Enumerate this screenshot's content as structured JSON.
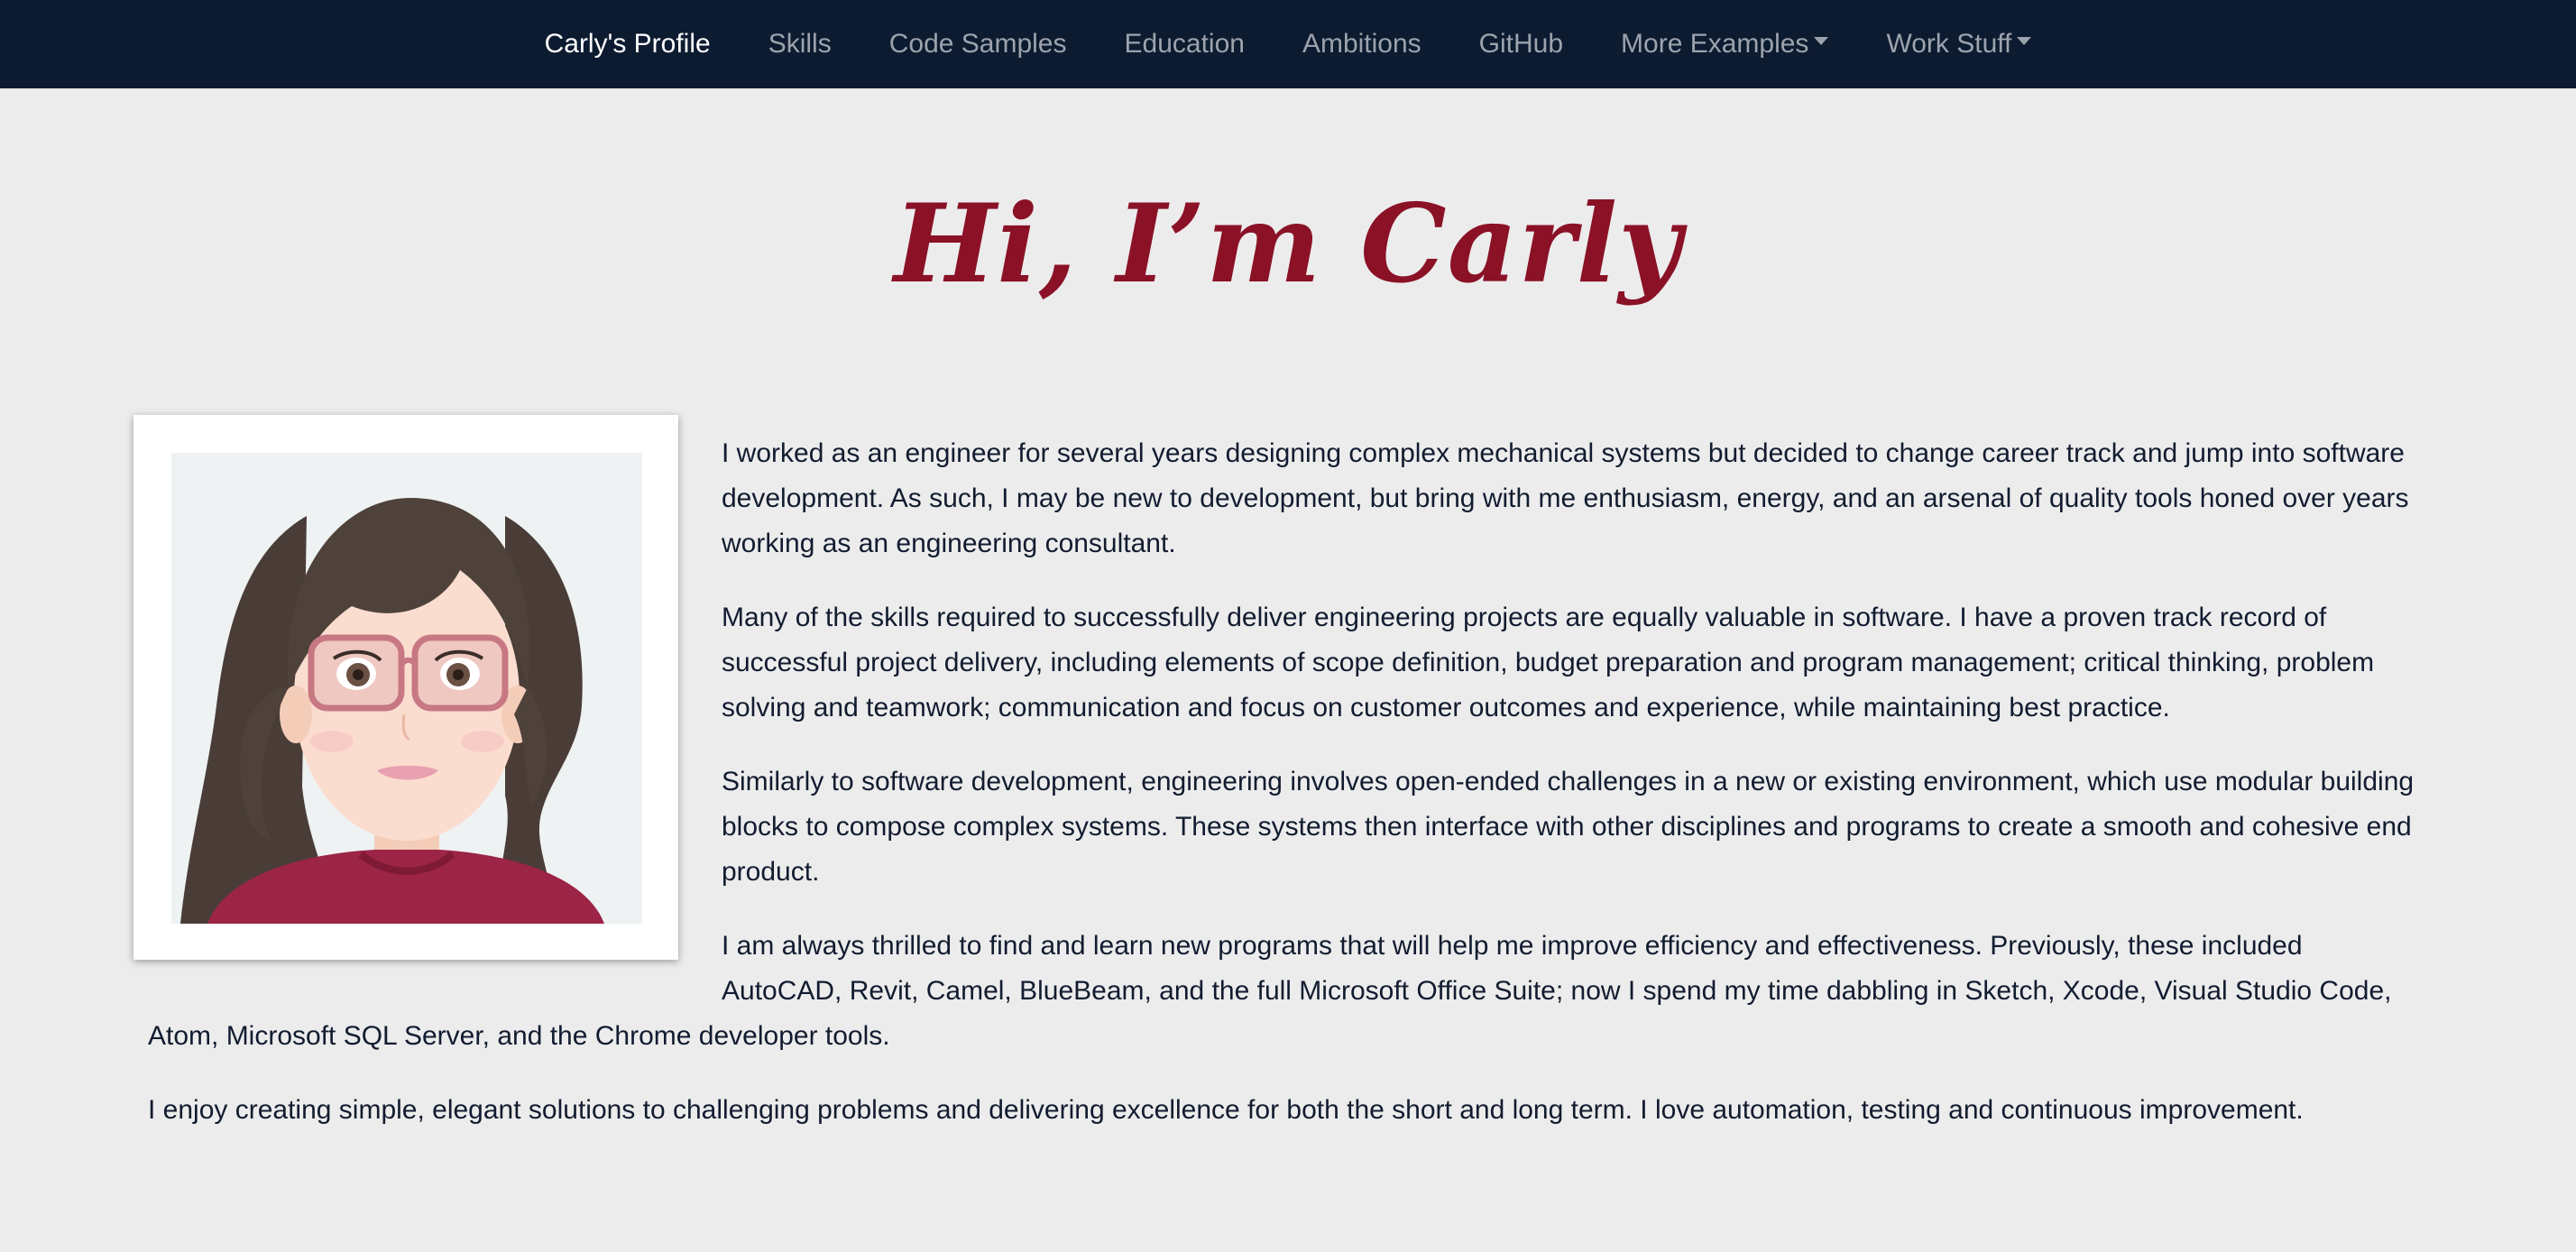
{
  "nav": {
    "items": [
      {
        "label": "Carly's Profile",
        "active": true,
        "dropdown": false
      },
      {
        "label": "Skills",
        "active": false,
        "dropdown": false
      },
      {
        "label": "Code Samples",
        "active": false,
        "dropdown": false
      },
      {
        "label": "Education",
        "active": false,
        "dropdown": false
      },
      {
        "label": "Ambitions",
        "active": false,
        "dropdown": false
      },
      {
        "label": "GitHub",
        "active": false,
        "dropdown": false
      },
      {
        "label": "More Examples",
        "active": false,
        "dropdown": true
      },
      {
        "label": "Work Stuff",
        "active": false,
        "dropdown": true
      }
    ]
  },
  "hero": {
    "title": "Hi, I’m Carly"
  },
  "portrait": {
    "icon": "avatar-illustration"
  },
  "about": {
    "paragraphs": [
      "I worked as an engineer for several years designing complex mechanical systems but decided to change career track and jump into software development. As such, I may be new to development, but bring with me enthusiasm, energy, and an arsenal of quality tools honed over years working as an engineering consultant.",
      "Many of the skills required to successfully deliver engineering projects are equally valuable in software. I have a proven track record of successful project delivery, including elements of scope definition, budget preparation and program management; critical thinking, problem solving and teamwork; communication and focus on customer outcomes and experience, while maintaining best practice.",
      "Similarly to software development, engineering involves open-ended challenges in a new or existing environment, which use modular building blocks to compose complex systems. These systems then interface with other disciplines and programs to create a smooth and cohesive end product.",
      "I am always thrilled to find and learn new programs that will help me improve efficiency and effectiveness. Previously, these included AutoCAD, Revit, Camel, BlueBeam, and the full Microsoft Office Suite; now I spend my time dabbling in Sketch, Xcode, Visual Studio Code, Atom, Microsoft SQL Server, and the Chrome developer tools.",
      "I enjoy creating simple, elegant solutions to challenging problems and delivering excellence for both the short and long term. I love automation, testing and continuous improvement."
    ]
  },
  "colors": {
    "nav_bg": "#0d1b30",
    "page_bg": "#ececec",
    "accent": "#8b1127"
  }
}
